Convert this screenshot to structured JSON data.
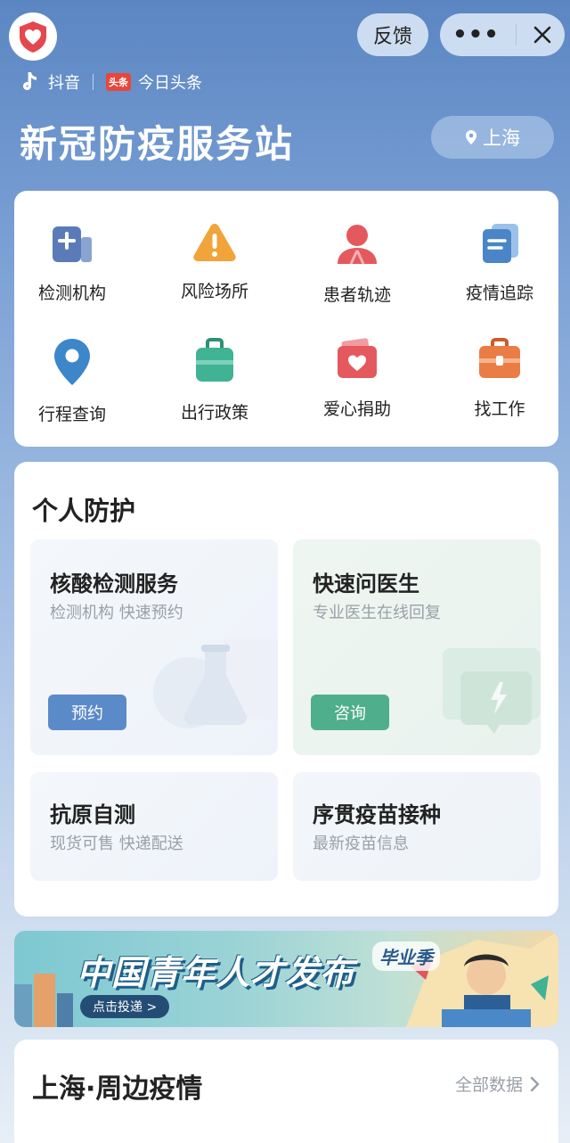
{
  "header": {
    "feedback_label": "反馈",
    "more_icon": "more-dots-icon",
    "close_icon": "close-icon",
    "brand_douyin": "抖音",
    "brand_toutiao_badge": "头条",
    "brand_toutiao": "今日头条",
    "title": "新冠防疫服务站",
    "location": "上海"
  },
  "grid": {
    "items": [
      {
        "label": "检测机构",
        "icon": "hospital-icon",
        "color": "#5b7bb8"
      },
      {
        "label": "风险场所",
        "icon": "warning-icon",
        "color": "#f0a43a"
      },
      {
        "label": "患者轨迹",
        "icon": "people-icon",
        "color": "#e4595e"
      },
      {
        "label": "疫情追踪",
        "icon": "documents-icon",
        "color": "#4a86c7"
      },
      {
        "label": "行程查询",
        "icon": "map-pin-icon",
        "color": "#3d86c9"
      },
      {
        "label": "出行政策",
        "icon": "luggage-icon",
        "color": "#3fb394"
      },
      {
        "label": "爱心捐助",
        "icon": "heart-card-icon",
        "color": "#e4595e"
      },
      {
        "label": "找工作",
        "icon": "briefcase-icon",
        "color": "#ea7d45"
      }
    ]
  },
  "protection": {
    "title": "个人防护",
    "tiles": [
      {
        "title": "核酸检测服务",
        "subtitle": "检测机构 快速预约",
        "button": "预约",
        "button_color": "#5b8ac9"
      },
      {
        "title": "快速问医生",
        "subtitle": "专业医生在线回复",
        "button": "咨询",
        "button_color": "#4fae8c"
      },
      {
        "title": "抗原自测",
        "subtitle": "现货可售 快递配送"
      },
      {
        "title": "序贯疫苗接种",
        "subtitle": "最新疫苗信息"
      }
    ]
  },
  "banner": {
    "title": "中国青年人才发布",
    "badge": "毕业季",
    "cta": "点击投递 >"
  },
  "epidemic": {
    "title": "上海·周边疫情",
    "link": "全部数据"
  }
}
